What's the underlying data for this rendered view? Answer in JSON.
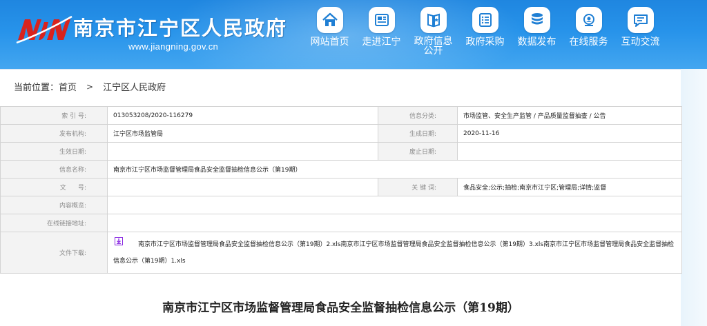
{
  "header": {
    "title": "南京市江宁区人民政府",
    "url": "www.jiangning.gov.cn",
    "logo_text": "NJN"
  },
  "nav": [
    {
      "label": "网站首页",
      "icon": "home-icon"
    },
    {
      "label": "走进江宁",
      "icon": "newspaper-icon"
    },
    {
      "label": "政府信息公开",
      "label_line1": "政府信息",
      "label_line2": "公开",
      "icon": "book-icon"
    },
    {
      "label": "政府采购",
      "icon": "list-icon"
    },
    {
      "label": "数据发布",
      "icon": "database-icon"
    },
    {
      "label": "在线服务",
      "icon": "service-icon"
    },
    {
      "label": "互动交流",
      "icon": "chat-icon"
    }
  ],
  "breadcrumb": {
    "prefix": "当前位置：",
    "home": "首页",
    "separator": ">",
    "current": "江宁区人民政府"
  },
  "info": {
    "index_label": "索 引 号:",
    "index_value": "013053208/2020-116279",
    "category_label": "信息分类:",
    "category_value": "市场监管、安全生产监管 / 产品质量监督抽查 / 公告",
    "publisher_label": "发布机构:",
    "publisher_value": "江宁区市场监管局",
    "created_label": "生成日期:",
    "created_value": "2020-11-16",
    "effective_label": "生效日期:",
    "effective_value": "",
    "repeal_label": "废止日期:",
    "repeal_value": "",
    "name_label": "信息名称:",
    "name_value": "南京市江宁区市场监督管理局食品安全监督抽检信息公示（第19期）",
    "doc_label": "文      号:",
    "doc_value": "",
    "keywords_label": "关 键 词:",
    "keywords_value": "食品安全;公示;抽检;南京市江宁区;管理局;详情;监督",
    "overview_label": "内容概览:",
    "overview_value": "",
    "link_label": "在线链接地址:",
    "link_value": "",
    "download_label": "文件下载:",
    "download_value": "南京市江宁区市场监督管理局食品安全监督抽检信息公示（第19期）2.xls南京市江宁区市场监督管理局食品安全监督抽检信息公示（第19期）3.xls南京市江宁区市场监督管理局食品安全监督抽检信息公示（第19期）1.xls"
  },
  "article": {
    "title": "南京市江宁区市场监督管理局食品安全监督抽检信息公示（第19期）"
  },
  "colors": {
    "header_blue": "#2793ea",
    "label_bg": "#f3f3f3",
    "download_icon": "#8a2be2"
  }
}
